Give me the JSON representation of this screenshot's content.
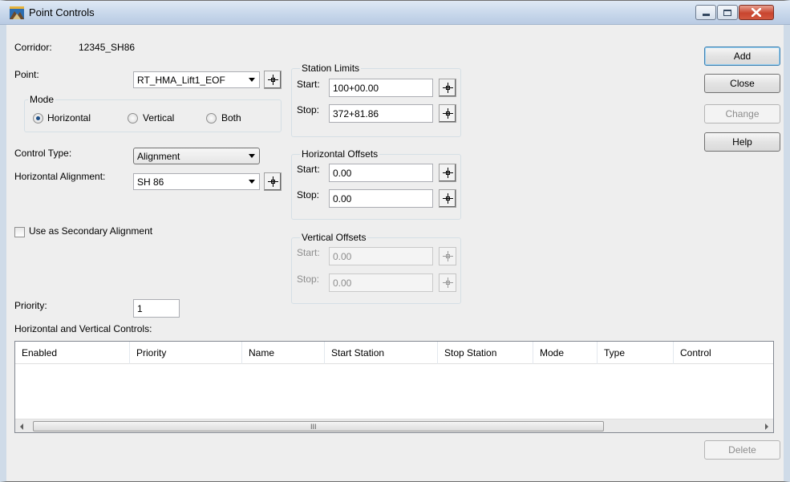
{
  "window": {
    "title": "Point Controls"
  },
  "corridor": {
    "label": "Corridor:",
    "value": "12345_SH86"
  },
  "point": {
    "label": "Point:",
    "value": "RT_HMA_Lift1_EOF"
  },
  "mode": {
    "title": "Mode",
    "options": [
      "Horizontal",
      "Vertical",
      "Both"
    ],
    "selected": "Horizontal"
  },
  "control_type": {
    "label": "Control Type:",
    "value": "Alignment"
  },
  "horizontal_alignment": {
    "label": "Horizontal Alignment:",
    "value": "SH 86"
  },
  "secondary": {
    "label": "Use as Secondary Alignment",
    "checked": false
  },
  "priority": {
    "label": "Priority:",
    "value": "1"
  },
  "station_limits": {
    "title": "Station Limits",
    "start_label": "Start:",
    "start": "100+00.00",
    "stop_label": "Stop:",
    "stop": "372+81.86"
  },
  "horizontal_offsets": {
    "title": "Horizontal Offsets",
    "start_label": "Start:",
    "start": "0.00",
    "stop_label": "Stop:",
    "stop": "0.00"
  },
  "vertical_offsets": {
    "title": "Vertical Offsets",
    "start_label": "Start:",
    "start": "0.00",
    "stop_label": "Stop:",
    "stop": "0.00"
  },
  "buttons": {
    "add": "Add",
    "close": "Close",
    "change": "Change",
    "help": "Help",
    "delete": "Delete"
  },
  "controls_list": {
    "label": "Horizontal and Vertical Controls:",
    "columns": [
      "Enabled",
      "Priority",
      "Name",
      "Start Station",
      "Stop Station",
      "Mode",
      "Type",
      "Control"
    ],
    "scroll_grip": "III"
  },
  "colors": {
    "close_button": "#c8452f",
    "default_button_border": "#3c7fb1",
    "titlebar": "#c6d6ea"
  }
}
